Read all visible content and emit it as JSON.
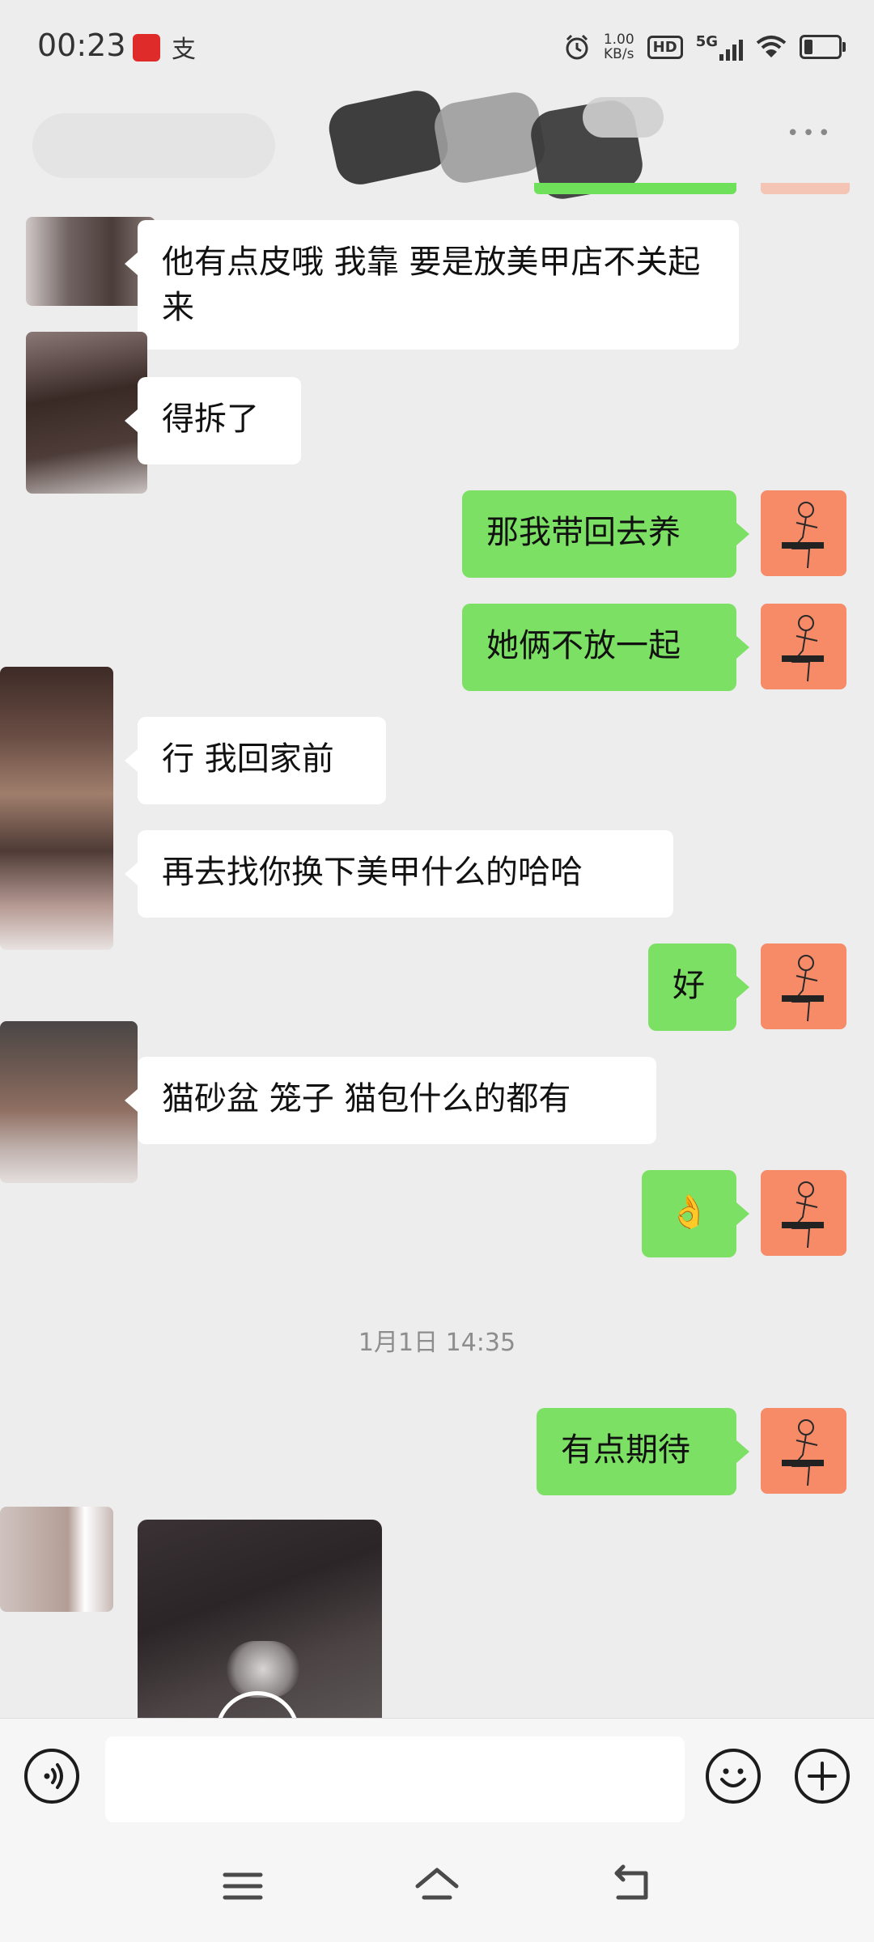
{
  "status_bar": {
    "time": "00:23",
    "app_icon_2": "支",
    "net_speed_value": "1.00",
    "net_speed_unit": "KB/s",
    "hd_badge": "HD",
    "network": "5G"
  },
  "messages": [
    {
      "side": "in",
      "text": "他有点皮哦 我靠 要是放美甲店不关起来"
    },
    {
      "side": "in",
      "text": "得拆了"
    },
    {
      "side": "out",
      "text": "那我带回去养"
    },
    {
      "side": "out",
      "text": "她俩不放一起"
    },
    {
      "side": "in",
      "text": "行 我回家前"
    },
    {
      "side": "in",
      "text": "再去找你换下美甲什么的哈哈"
    },
    {
      "side": "out",
      "text": "好"
    },
    {
      "side": "in",
      "text": "猫砂盆 笼子 猫包什么的都有"
    },
    {
      "side": "out",
      "text": "👌"
    },
    {
      "side": "out",
      "text": "有点期待"
    }
  ],
  "timestamp": "1月1日 14:35",
  "colors": {
    "background": "#ededed",
    "bubble_out": "#7be063",
    "bubble_in": "#ffffff",
    "avatar_self": "#f78a67"
  },
  "icons": {
    "voice": "voice-input-icon",
    "emoji": "emoji-icon",
    "add": "plus-icon",
    "menu": "menu-icon",
    "home": "home-icon",
    "back": "back-icon"
  }
}
